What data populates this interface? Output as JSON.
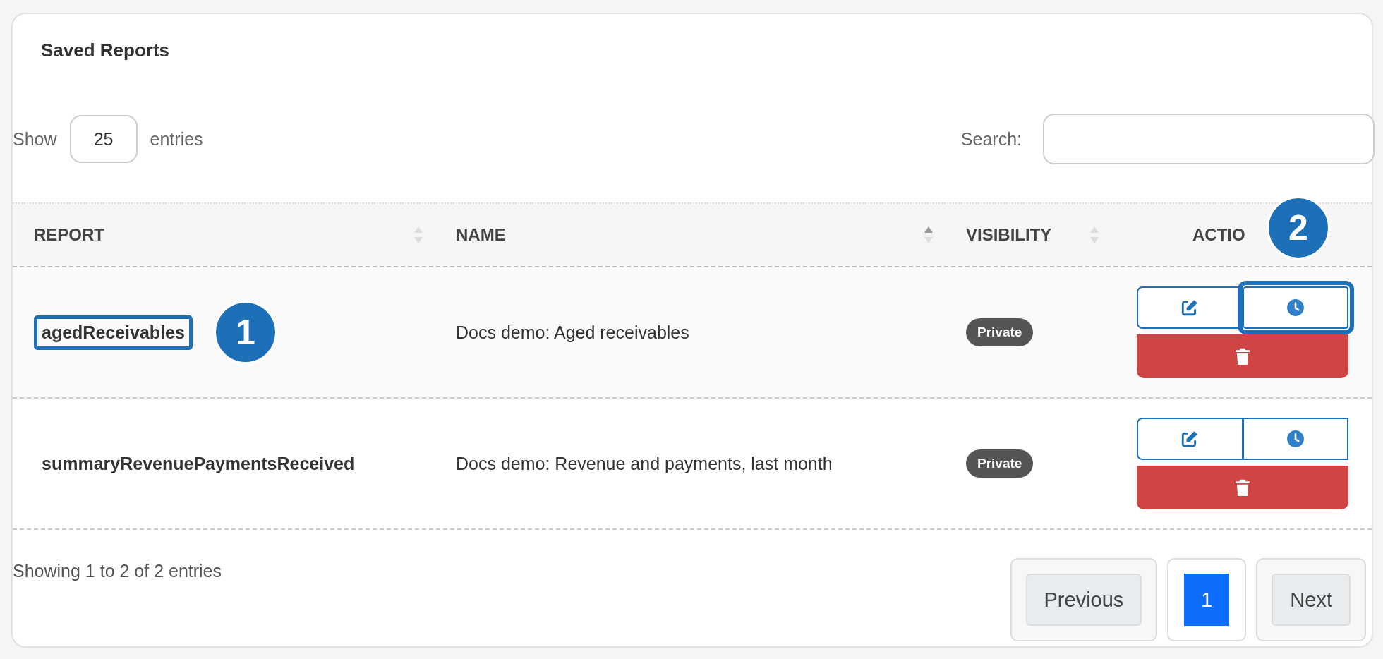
{
  "title": "Saved Reports",
  "length": {
    "label_before": "Show",
    "value": "25",
    "label_after": "entries"
  },
  "search": {
    "label": "Search:"
  },
  "table": {
    "columns": [
      {
        "label": "REPORT",
        "sortable": true,
        "sorted_ascending": false
      },
      {
        "label": "NAME",
        "sortable": true,
        "sorted_ascending": true
      },
      {
        "label": "VISIBILITY",
        "sortable": true,
        "sorted_ascending": false
      },
      {
        "label": "ACTIO",
        "sortable": false
      }
    ],
    "rows": [
      {
        "report": "agedReceivables",
        "name": "Docs demo: Aged receivables",
        "visibility": "Private",
        "report_callout": "1",
        "schedule_callout": "2"
      },
      {
        "report": "summaryRevenuePaymentsReceived",
        "name": "Docs demo: Revenue and payments, last month",
        "visibility": "Private"
      }
    ]
  },
  "info": "Showing 1 to 2 of 2 entries",
  "pagination": [
    {
      "label": "Previous",
      "kind": "nav",
      "selected": false
    },
    {
      "label": "1",
      "kind": "page",
      "selected": true
    },
    {
      "label": "Next",
      "kind": "nav",
      "selected": false
    }
  ]
}
